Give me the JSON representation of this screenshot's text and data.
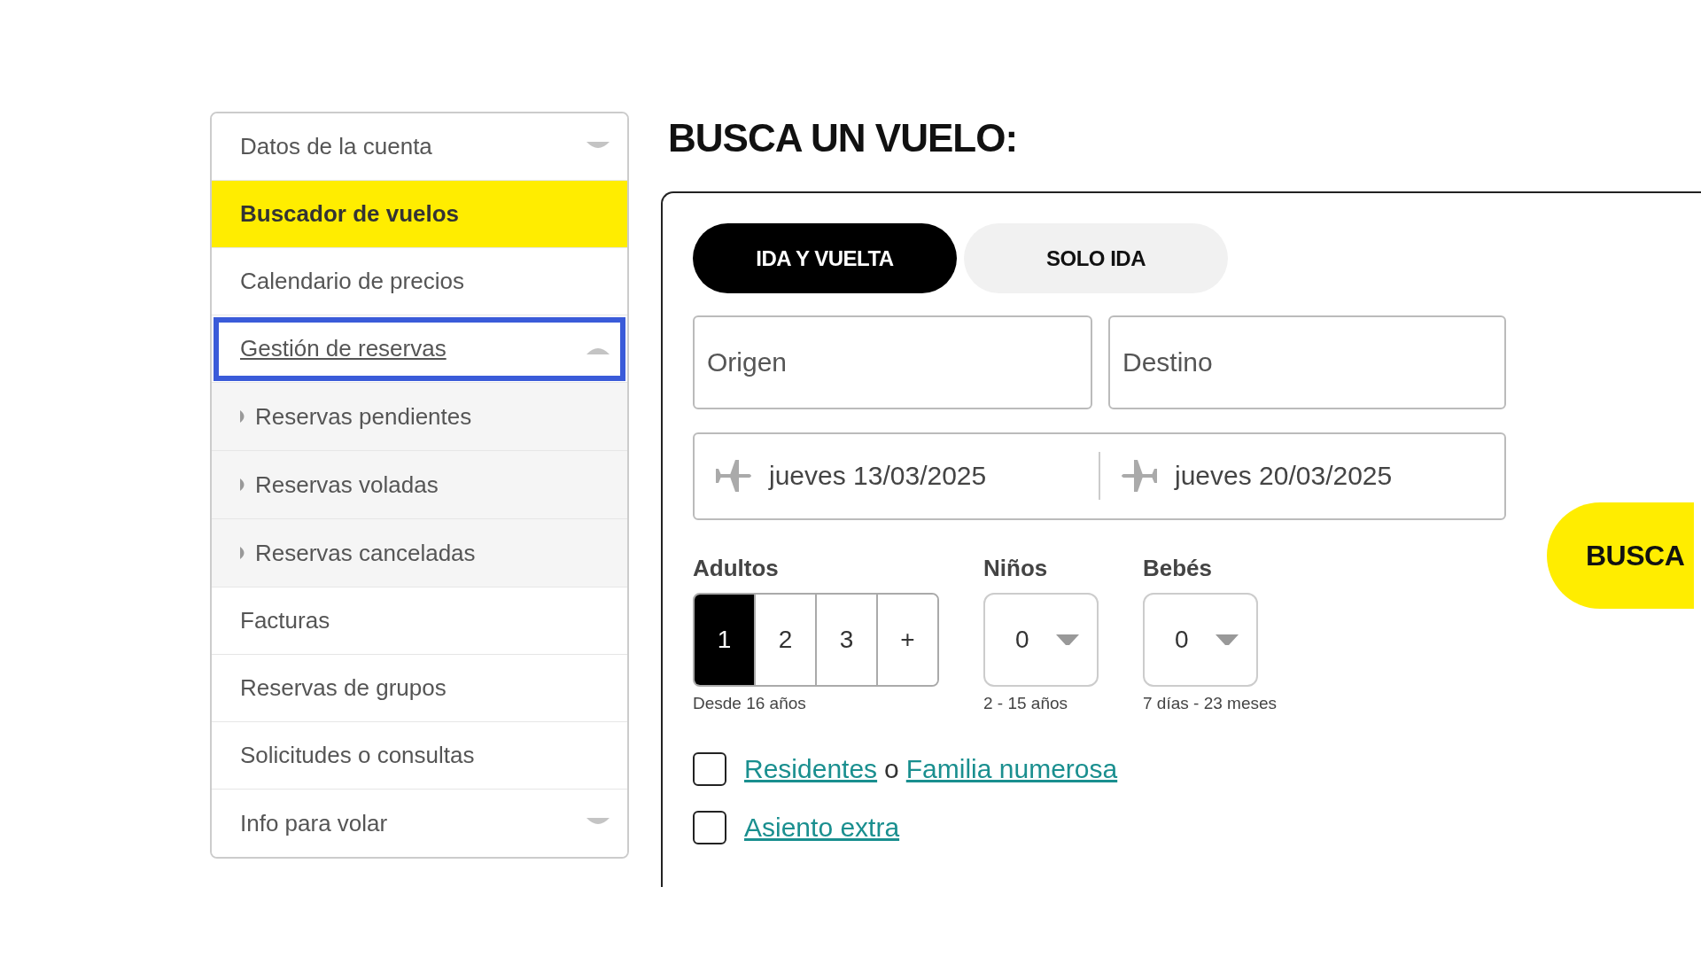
{
  "sidebar": {
    "items": [
      {
        "label": "Datos de la cuenta",
        "kind": "group",
        "selected": false,
        "expanded": false,
        "focused": false
      },
      {
        "label": "Buscador de vuelos",
        "kind": "link",
        "selected": true,
        "focused": false
      },
      {
        "label": "Calendario de precios",
        "kind": "link",
        "selected": false,
        "focused": false
      },
      {
        "label": "Gestión de reservas",
        "kind": "group",
        "selected": false,
        "expanded": true,
        "focused": true,
        "children": [
          {
            "label": "Reservas pendientes",
            "selected": false
          },
          {
            "label": "Reservas voladas",
            "selected": false
          },
          {
            "label": "Reservas canceladas",
            "selected": false
          }
        ]
      },
      {
        "label": "Facturas",
        "kind": "link",
        "selected": false,
        "focused": false
      },
      {
        "label": "Reservas de grupos",
        "kind": "link",
        "selected": false,
        "focused": false
      },
      {
        "label": "Solicitudes o consultas",
        "kind": "link",
        "selected": false,
        "focused": false
      },
      {
        "label": "Info para volar",
        "kind": "group",
        "selected": false,
        "expanded": false,
        "focused": false
      }
    ]
  },
  "page_title": "BUSCA UN VUELO:",
  "search_form": {
    "trip_types": [
      {
        "label": "IDA Y VUELTA",
        "selected": true
      },
      {
        "label": "SOLO IDA",
        "selected": false
      }
    ],
    "origin": {
      "placeholder": "Origen"
    },
    "destination": {
      "placeholder": "Destino"
    },
    "dates": [
      {
        "value": "jueves 13/03/2025",
        "kind": "departure"
      },
      {
        "value": "jueves 20/03/2025",
        "kind": "return"
      }
    ],
    "passengers": [
      {
        "label": "Adultos",
        "kind": "segmented",
        "options": [
          {
            "label": "1",
            "selected": true
          },
          {
            "label": "2",
            "selected": false
          },
          {
            "label": "3",
            "selected": false
          },
          {
            "label": "+",
            "selected": false
          }
        ],
        "hint": "Desde 16 años"
      },
      {
        "label": "Niños",
        "kind": "dropdown",
        "value": "0",
        "hint": "2 - 15 años"
      },
      {
        "label": "Bebés",
        "kind": "dropdown",
        "value": "0",
        "hint": "7 días - 23 meses"
      }
    ],
    "options": [
      {
        "checked": false,
        "parts": [
          {
            "text": "Residentes",
            "kind": "link"
          },
          {
            "text": "o",
            "kind": "text"
          },
          {
            "text": "Familia numerosa",
            "kind": "link"
          }
        ]
      },
      {
        "checked": false,
        "parts": [
          {
            "text": "Asiento extra",
            "kind": "link"
          }
        ]
      }
    ],
    "search_button": {
      "label": "BUSCA"
    }
  }
}
